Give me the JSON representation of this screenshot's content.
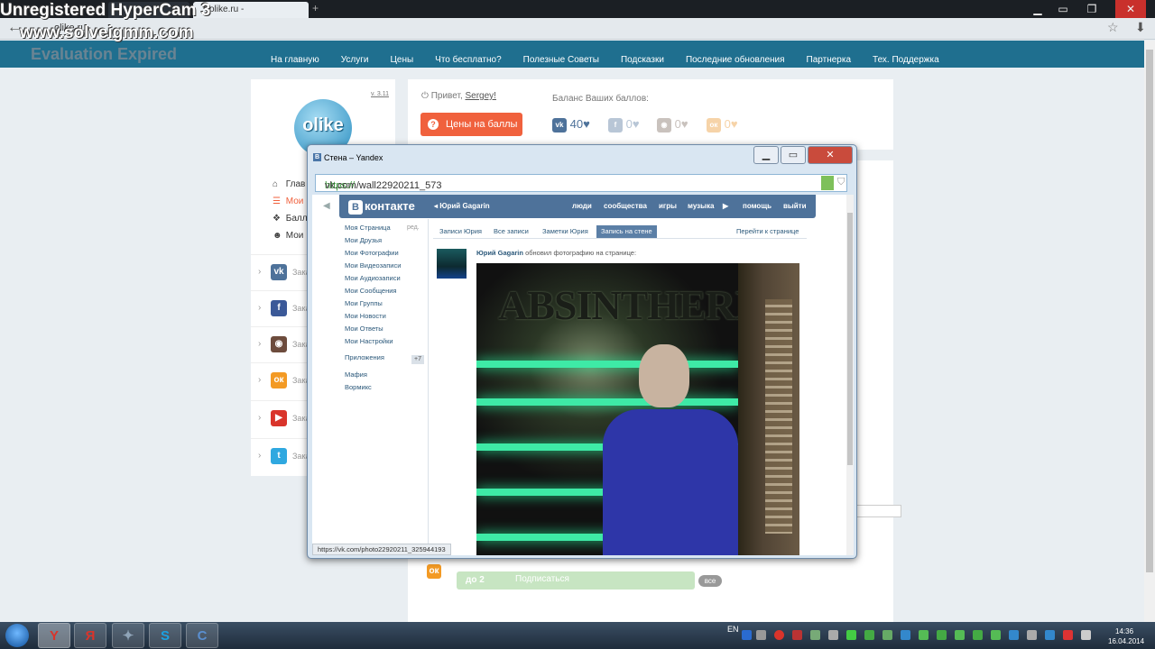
{
  "watermark": {
    "line1": "Unregistered HyperCam 3",
    "line2": "www.solveigmm.com",
    "line3": "Evaluation Expired"
  },
  "browser": {
    "tabs": [
      "olike.ru -"
    ],
    "address": "olike.ru",
    "colors": {
      "accent": "#1f6f8f"
    }
  },
  "site_nav": [
    "На главную",
    "Услуги",
    "Цены",
    "Что бесплатно?",
    "Полезные Советы",
    "Подсказки",
    "Последние обновления",
    "Партнерка",
    "Тех. Поддержка"
  ],
  "sidebar": {
    "version": "v. 3.11",
    "logo_text": "olike",
    "menu": [
      {
        "icon": "home-icon",
        "label": "Глав"
      },
      {
        "icon": "list-icon",
        "label": "Мои"
      },
      {
        "icon": "gift-icon",
        "label": "Балл"
      },
      {
        "icon": "users-icon",
        "label": "Мои"
      }
    ],
    "socials": [
      {
        "icon": "vk-icon",
        "badge": "vk",
        "color": "#4e729a",
        "label": "Зака"
      },
      {
        "icon": "facebook-icon",
        "badge": "f",
        "color": "#3b5998",
        "label": "Зака"
      },
      {
        "icon": "instagram-icon",
        "badge": "◉",
        "color": "#6d4c3d",
        "label": "Зака"
      },
      {
        "icon": "odnoklassniki-icon",
        "badge": "ок",
        "color": "#f39a24",
        "label": "Зака"
      },
      {
        "icon": "youtube-icon",
        "badge": "▶",
        "color": "#d9342b",
        "label": "Зака"
      },
      {
        "icon": "twitter-icon",
        "badge": "t",
        "color": "#2fa8e0",
        "label": "Зака"
      }
    ]
  },
  "top_panel": {
    "greeting": "Привет,",
    "username": "Sergey!",
    "price_button": "Цены на баллы",
    "balance_label": "Баланс Ваших баллов:",
    "balances": [
      {
        "icon": "vk-icon",
        "badge": "vk",
        "value": "40♥",
        "color": "#4e729a"
      },
      {
        "icon": "facebook-icon",
        "badge": "f",
        "value": "0♥",
        "color": "#b8c6d6"
      },
      {
        "icon": "instagram-icon",
        "badge": "◉",
        "value": "0♥",
        "color": "#c9c2bd"
      },
      {
        "icon": "odnoklassniki-icon",
        "badge": "ок",
        "value": "0♥",
        "color": "#f6d3a8"
      }
    ]
  },
  "bottom_panel": {
    "count": "до 2",
    "subscribe": "Подписаться",
    "all": "все"
  },
  "popup": {
    "title": "Стена – Yandex",
    "url_scheme": "https://",
    "url_rest": "vk.com/wall22920211_573",
    "status_url": "https://vk.com/photo22920211_325944193",
    "vk": {
      "logo": "контакте",
      "logo_badge": "В",
      "user": "Юрий Gagarin",
      "nav": [
        "люди",
        "сообщества",
        "игры",
        "музыка",
        "помощь",
        "выйти"
      ],
      "menu": [
        "Моя Страница",
        "Мои Друзья",
        "Мои Фотографии",
        "Мои Видеозаписи",
        "Мои Аудиозаписи",
        "Мои Сообщения",
        "Мои Группы",
        "Мои Новости",
        "Мои Ответы",
        "Мои Настройки",
        "Приложения",
        "Мафия",
        "Вормикс"
      ],
      "edit": "ред.",
      "apps_plus": "+7",
      "tabs": [
        "Записи Юрия",
        "Все записи",
        "Заметки Юрия",
        "Запись на стене"
      ],
      "goto": "Перейти к странице",
      "post_author": "Юрий Gagarin",
      "post_text": "обновил фотографию на странице:",
      "photo_sign": "ABSINTHERIE"
    }
  },
  "taskbar": {
    "lang": "EN",
    "time": "14:36",
    "date": "16.04.2014",
    "apps": [
      {
        "icon": "yandex-browser-icon",
        "glyph": "Y",
        "color": "#d9342b"
      },
      {
        "icon": "yandex-icon",
        "glyph": "Я",
        "color": "#d9342b"
      },
      {
        "icon": "wings-icon",
        "glyph": "✦",
        "color": "#8fa4b8"
      },
      {
        "icon": "skype-icon",
        "glyph": "S",
        "color": "#1ba1e2"
      },
      {
        "icon": "app-icon",
        "glyph": "C",
        "color": "#5a8fd0"
      }
    ]
  }
}
